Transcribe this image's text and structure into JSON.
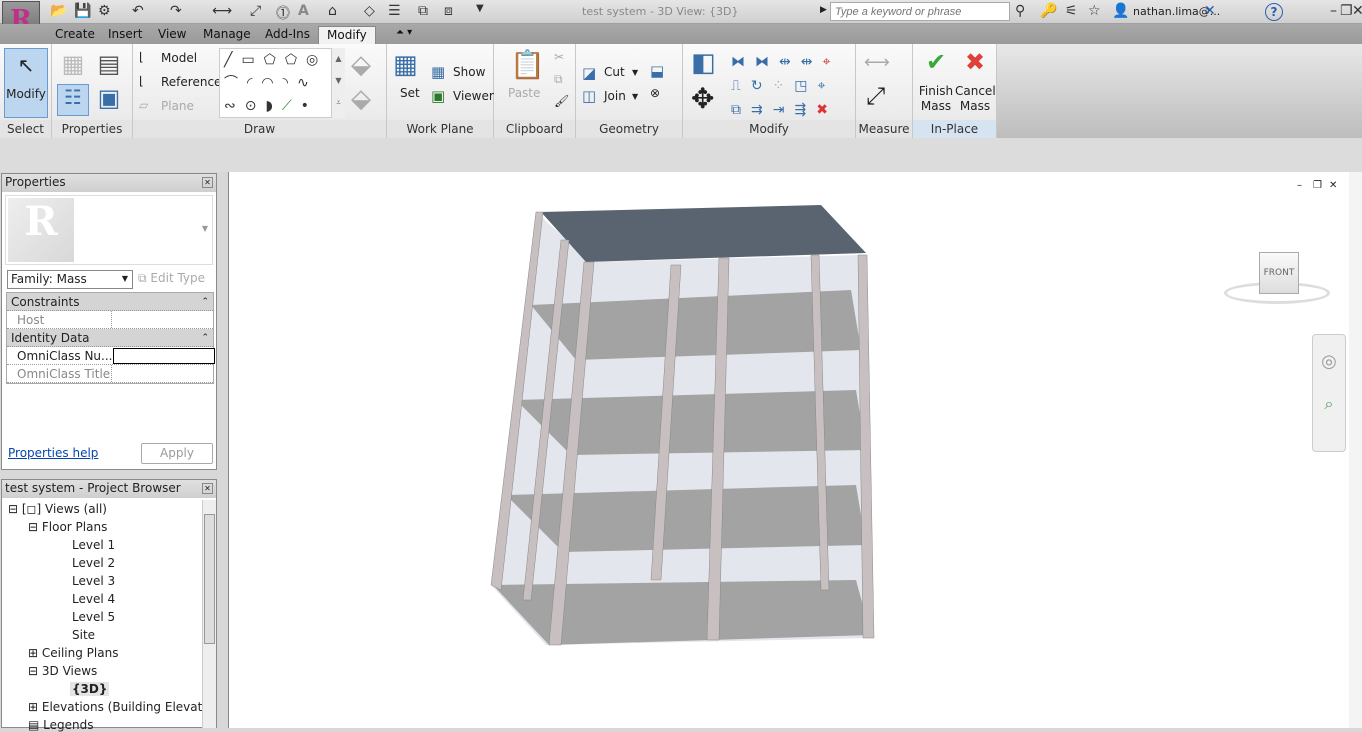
{
  "titlebar": {
    "app_letter": "R",
    "app_sub": "A",
    "title": "test system - 3D View: {3D}",
    "search_placeholder": "Type a keyword or phrase",
    "user": "nathan.lima@...",
    "help": "?"
  },
  "tabs": [
    "Create",
    "Insert",
    "View",
    "Manage",
    "Add-Ins",
    "Modify"
  ],
  "ribbon": {
    "select": {
      "label": "Select",
      "modify": "Modify"
    },
    "properties": {
      "label": "Properties"
    },
    "draw": {
      "label": "Draw",
      "model": "Model",
      "reference": "Reference",
      "plane": "Plane"
    },
    "work_plane": {
      "label": "Work Plane",
      "set": "Set",
      "show": "Show",
      "viewer": "Viewer"
    },
    "clipboard": {
      "label": "Clipboard",
      "paste": "Paste"
    },
    "geometry": {
      "label": "Geometry",
      "cut": "Cut",
      "join": "Join"
    },
    "modify": {
      "label": "Modify"
    },
    "measure": {
      "label": "Measure"
    },
    "inplace": {
      "label": "In-Place Editor",
      "finish1": "Finish",
      "finish2": "Mass",
      "cancel1": "Cancel",
      "cancel2": "Mass"
    }
  },
  "properties": {
    "title": "Properties",
    "family": "Family: Mass",
    "edit_type": "Edit Type",
    "sections": [
      {
        "name": "Constraints",
        "rows": [
          {
            "label": "Host",
            "value": ""
          }
        ]
      },
      {
        "name": "Identity Data",
        "rows": [
          {
            "label": "OmniClass Nu...",
            "value": ""
          },
          {
            "label": "OmniClass Title",
            "value": ""
          }
        ]
      }
    ],
    "help": "Properties help",
    "apply": "Apply"
  },
  "browser": {
    "title": "test system - Project Browser",
    "views_all": "Views (all)",
    "floor_plans": "Floor Plans",
    "levels": [
      "Level 1",
      "Level 2",
      "Level 3",
      "Level 4",
      "Level 5",
      "Site"
    ],
    "ceiling_plans": "Ceiling Plans",
    "views_3d": "3D Views",
    "view_3d": "{3D}",
    "elevations": "Elevations (Building Elevatio",
    "legends": "Legends"
  },
  "viewcube": {
    "face": "FRONT"
  }
}
